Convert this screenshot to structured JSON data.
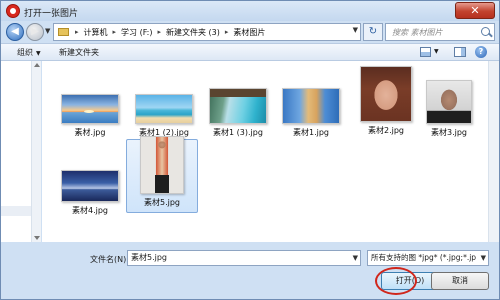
{
  "window": {
    "title": "打开一张图片",
    "close_label": "✕"
  },
  "address": {
    "crumbs": [
      "计算机",
      "学习 (F:)",
      "新建文件夹 (3)",
      "素材图片"
    ],
    "search_placeholder": "搜索 素材图片"
  },
  "toolbar": {
    "organize_label": "组织",
    "new_folder_label": "新建文件夹"
  },
  "files": [
    {
      "name": "素材.jpg",
      "selected": false
    },
    {
      "name": "素材1 (2).jpg",
      "selected": false
    },
    {
      "name": "素材1 (3).jpg",
      "selected": false
    },
    {
      "name": "素材1.jpg",
      "selected": false
    },
    {
      "name": "素材2.jpg",
      "selected": false
    },
    {
      "name": "素材3.jpg",
      "selected": false
    },
    {
      "name": "素材4.jpg",
      "selected": false
    },
    {
      "name": "素材5.jpg",
      "selected": true
    }
  ],
  "bottom": {
    "filename_label": "文件名(N):",
    "filename_value": "素材5.jpg",
    "filetype_value": "所有支持的图 *jpg* (*.jpg;*.jp",
    "open_label": "打开(O)",
    "cancel_label": "取消"
  },
  "colors": {
    "selection": "#cfe4fa",
    "annotation_circle": "#d0261b"
  }
}
